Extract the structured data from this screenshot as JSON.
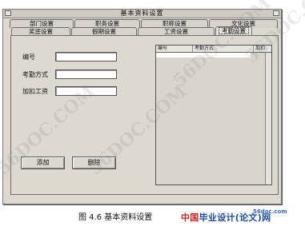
{
  "window": {
    "title": "基本资料设置"
  },
  "tabs": {
    "row_back": [
      "部门设置",
      "职务设置",
      "职称设置",
      "文化设置"
    ],
    "row_front": [
      "奖惩设置",
      "假期设置",
      "工资设置",
      "考勤设置"
    ],
    "active": "考勤设置"
  },
  "form": {
    "fields": [
      {
        "label": "编号",
        "value": ""
      },
      {
        "label": "考勤方式",
        "value": ""
      },
      {
        "label": "加扣工资",
        "value": ""
      }
    ],
    "add_button": "添加",
    "delete_button": "删除"
  },
  "grid": {
    "columns": [
      "编号",
      "考勤方式",
      "加扣"
    ]
  },
  "caption": {
    "text": "图 4.6  基本资料设置"
  },
  "brand": {
    "url": "56doc.com",
    "name_a": "中国",
    "name_b": "毕业设计(论文)网"
  },
  "watermark": {
    "text": "56DOC.COM"
  },
  "colors": {
    "window_bg": "#ddd9d1",
    "brand_blue": "#1a4aa8",
    "brand_red": "#cc2222"
  }
}
